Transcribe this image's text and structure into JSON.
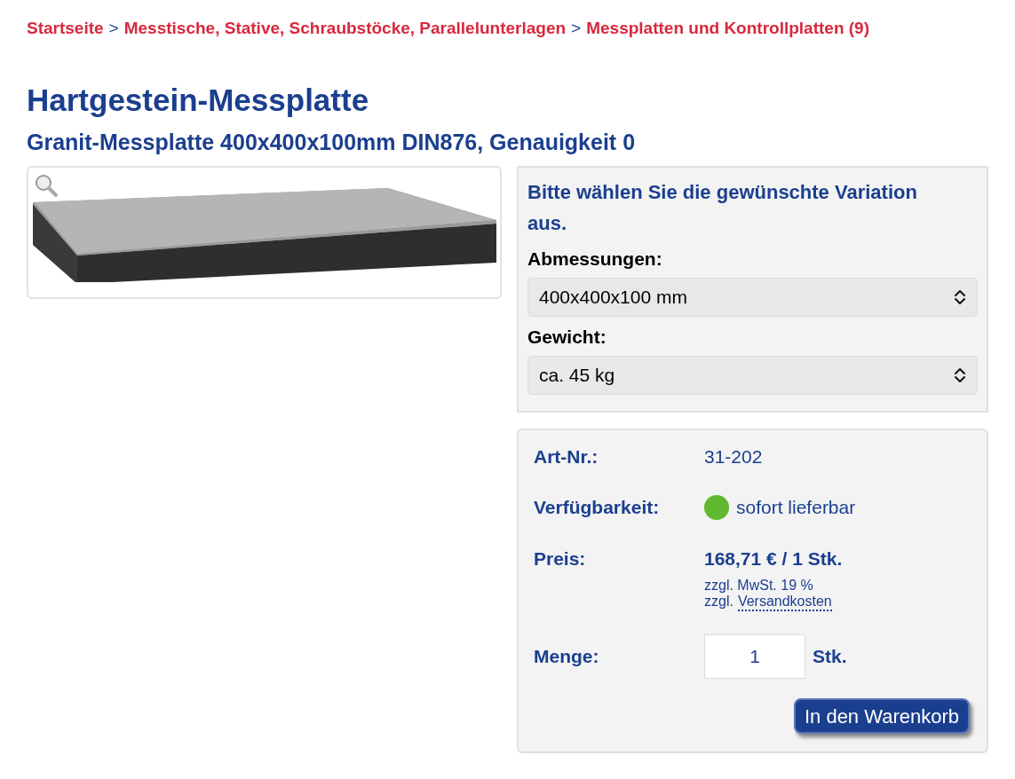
{
  "breadcrumb": [
    {
      "label": "Startseite"
    },
    {
      "label": "Messtische, Stative, Schraubstöcke, Parallelunterlagen"
    },
    {
      "label": "Messplatten und Kontrollplatten (9)"
    }
  ],
  "breadcrumb_separator": ">",
  "title": "Hartgestein-Messplatte",
  "subtitle": "Granit-Messplatte 400x400x100mm DIN876, Genauigkeit 0",
  "variation": {
    "prompt": "Bitte wählen Sie die gewünschte Variation aus.",
    "selects": [
      {
        "label": "Abmessungen:",
        "value": "400x400x100 mm"
      },
      {
        "label": "Gewicht:",
        "value": "ca. 45 kg"
      }
    ]
  },
  "details": {
    "article_label": "Art-Nr.:",
    "article_number": "31-202",
    "availability_label": "Verfügbarkeit:",
    "availability": {
      "text": "sofort lieferbar",
      "kind": "in_stock"
    },
    "price_label": "Preis:",
    "price": "168,71 € / 1 Stk.",
    "tax_note": "zzgl. MwSt. 19 %",
    "shipping_prefix": "zzgl.",
    "shipping_link": "Versandkosten",
    "quantity_label": "Menge:",
    "quantity": "1",
    "quantity_unit": "Stk.",
    "cart_button": "In den Warenkorb"
  }
}
